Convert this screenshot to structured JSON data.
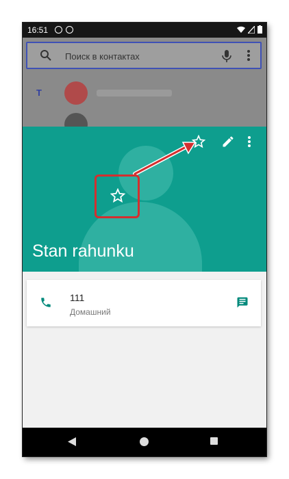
{
  "status_bar": {
    "time": "16:51",
    "icon_left_1": "signal-ring-icon",
    "icon_left_2": "sync-icon"
  },
  "search": {
    "placeholder": "Поиск в контактах"
  },
  "list": {
    "section_letter": "T"
  },
  "contact": {
    "name": "Stan rahunku",
    "phone_number": "111",
    "phone_type": "Домашний"
  },
  "colors": {
    "header": "#0e9e8e",
    "accent": "#00897b",
    "highlight": "#d32f2f",
    "search_border": "#3f51b5"
  },
  "icons": {
    "star": "star-outline-icon",
    "edit": "pencil-icon",
    "more": "more-vert-icon",
    "phone": "phone-icon",
    "message": "message-icon"
  }
}
